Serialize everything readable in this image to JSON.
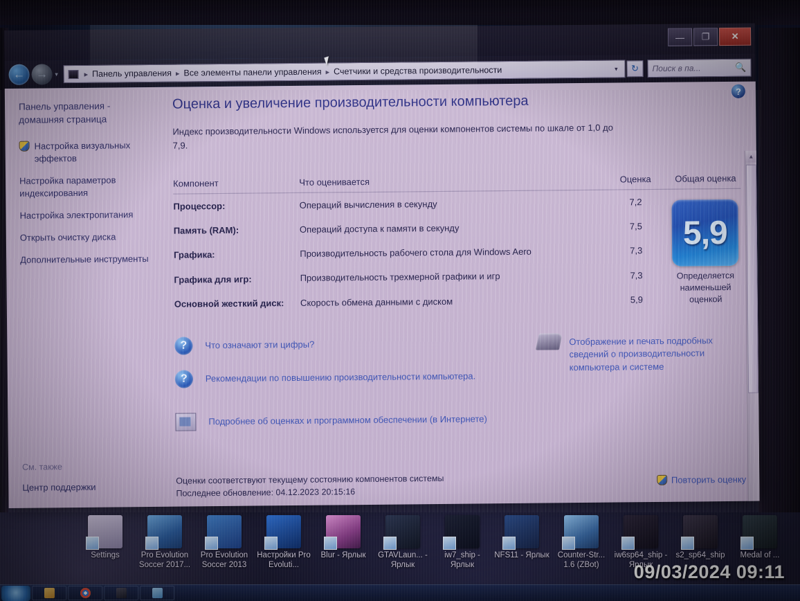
{
  "window": {
    "controls": {
      "minimize": "—",
      "maximize": "❐",
      "close": "✕"
    },
    "nav": {
      "back": "←",
      "forward": "→",
      "recent_dropdown": "▾"
    }
  },
  "address_bar": {
    "crumbs": [
      "Панель управления",
      "Все элементы панели управления",
      "Счетчики и средства производительности"
    ],
    "separator": "▸",
    "dropdown_chevron": "▾",
    "refresh": "↻"
  },
  "search": {
    "placeholder": "Поиск в па...",
    "icon": "🔍"
  },
  "sidebar": {
    "home": "Панель управления - домашняя страница",
    "items": [
      {
        "label": "Настройка визуальных эффектов",
        "shield": true
      },
      {
        "label": "Настройка параметров индексирования",
        "shield": false
      },
      {
        "label": "Настройка электропитания",
        "shield": false
      },
      {
        "label": "Открыть очистку диска",
        "shield": false
      },
      {
        "label": "Дополнительные инструменты",
        "shield": false
      }
    ],
    "see_also_label": "См. также",
    "see_also_link": "Центр поддержки"
  },
  "main": {
    "title": "Оценка и увеличение производительности компьютера",
    "description": "Индекс производительности Windows используется для оценки компонентов системы по шкале от 1,0 до 7,9.",
    "help_orb": "?"
  },
  "table": {
    "headers": {
      "component": "Компонент",
      "what": "Что оценивается",
      "score": "Оценка",
      "base": "Общая оценка"
    },
    "rows": [
      {
        "component": "Процессор:",
        "what": "Операций вычисления в секунду",
        "score": "7,2"
      },
      {
        "component": "Память (RAM):",
        "what": "Операций доступа к памяти в секунду",
        "score": "7,5"
      },
      {
        "component": "Графика:",
        "what": "Производительность рабочего стола для Windows Aero",
        "score": "7,3"
      },
      {
        "component": "Графика для игр:",
        "what": "Производительность трехмерной графики и игр",
        "score": "7,3"
      },
      {
        "component": "Основной жесткий диск:",
        "what": "Скорость обмена данными с диском",
        "score": "5,9"
      }
    ]
  },
  "base_score": {
    "value": "5,9",
    "caption": "Определяется наименьшей оценкой",
    "color": "#1f4fb4"
  },
  "links": [
    {
      "label": "Что означают эти цифры?",
      "icon": "question-mark"
    },
    {
      "label": "Рекомендации по повышению производительности компьютера.",
      "icon": "question-mark"
    },
    {
      "label": "Подробнее об оценках и программном обеспечении (в Интернете)",
      "icon": "book"
    }
  ],
  "print_link": {
    "label": "Отображение и печать подробных сведений о производительности компьютера и системе",
    "icon": "printer"
  },
  "footer": {
    "note_line1": "Оценки соответствуют текущему состоянию компонентов системы",
    "note_line2": "Последнее обновление: 04.12.2023 20:15:16",
    "recheck_label": "Повторить оценку"
  },
  "scrollbar": {
    "up": "▲",
    "down": "▼"
  },
  "desktop_icons": [
    {
      "label": "Settings",
      "tile": "t-settings"
    },
    {
      "label": "Pro Evolution Soccer 2017...",
      "tile": "t-pes17"
    },
    {
      "label": "Pro Evolution Soccer 2013",
      "tile": "t-pes13"
    },
    {
      "label": "Настройки Pro Evoluti...",
      "tile": "t-pes18"
    },
    {
      "label": "Blur - Ярлык",
      "tile": "t-blur"
    },
    {
      "label": "GTAVLaun... - Ярлык",
      "tile": "t-gtav"
    },
    {
      "label": "iw7_ship - Ярлык",
      "tile": "t-iw7"
    },
    {
      "label": "NFS11 - Ярлык",
      "tile": "t-nfs"
    },
    {
      "label": "Counter-Str... 1.6 (ZBot)",
      "tile": "t-cs"
    },
    {
      "label": "iw6sp64_ship - Ярлык",
      "tile": "t-iw6"
    },
    {
      "label": "s2_sp64_ship",
      "tile": "t-s2"
    },
    {
      "label": "Medal of ...",
      "tile": "t-medal"
    }
  ],
  "camera_stamp": "09/03/2024  09:11"
}
